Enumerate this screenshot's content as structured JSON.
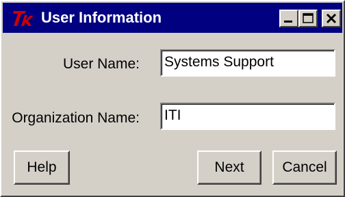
{
  "window": {
    "title": "User Information",
    "logo_text": "Tk",
    "title_bar_color": "#000080"
  },
  "title_buttons": {
    "minimize_icon": "minimize-icon",
    "maximize_icon": "maximize-icon",
    "close_icon": "close-icon"
  },
  "form": {
    "user_name_label": "User Name:",
    "user_name_value": "Systems Support",
    "organization_name_label": "Organization Name:",
    "organization_name_value": "ITI"
  },
  "buttons": {
    "help_label": "Help",
    "next_label": "Next",
    "cancel_label": "Cancel"
  }
}
